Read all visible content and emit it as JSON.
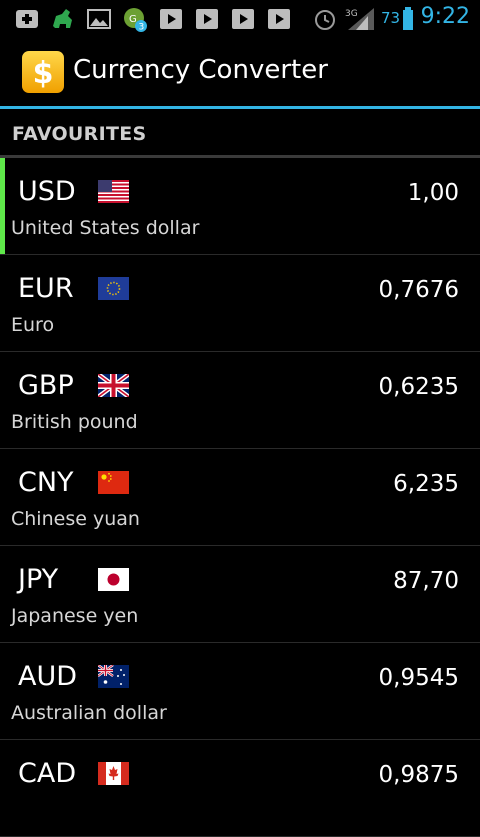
{
  "status_bar": {
    "icons": [
      "add-notification-icon",
      "android-app-icon",
      "gallery-icon",
      "gs-app-icon",
      "play-store-icon",
      "play-store-icon",
      "play-store-icon",
      "play-store-icon",
      "alarm-icon",
      "signal-3g-icon",
      "battery-icon"
    ],
    "badge": "3",
    "network": "3G",
    "battery_percent": "73",
    "time": "9:22"
  },
  "action_bar": {
    "title": "Currency Converter",
    "icon": "dollar-app-icon",
    "accent": "#33b5e5"
  },
  "section": {
    "title": "FAVOURITES"
  },
  "currencies": [
    {
      "code": "USD",
      "name": "United States dollar",
      "value": "1,00",
      "flag": "us-flag-icon",
      "selected": true
    },
    {
      "code": "EUR",
      "name": "Euro",
      "value": "0,7676",
      "flag": "eu-flag-icon",
      "selected": false
    },
    {
      "code": "GBP",
      "name": "British pound",
      "value": "0,6235",
      "flag": "uk-flag-icon",
      "selected": false
    },
    {
      "code": "CNY",
      "name": "Chinese yuan",
      "value": "6,235",
      "flag": "cn-flag-icon",
      "selected": false
    },
    {
      "code": "JPY",
      "name": "Japanese yen",
      "value": "87,70",
      "flag": "jp-flag-icon",
      "selected": false
    },
    {
      "code": "AUD",
      "name": "Australian dollar",
      "value": "0,9545",
      "flag": "au-flag-icon",
      "selected": false
    },
    {
      "code": "CAD",
      "name": "",
      "value": "0,9875",
      "flag": "ca-flag-icon",
      "selected": false
    }
  ],
  "colors": {
    "selected_indicator": "#5fe84a",
    "background": "#000000"
  }
}
